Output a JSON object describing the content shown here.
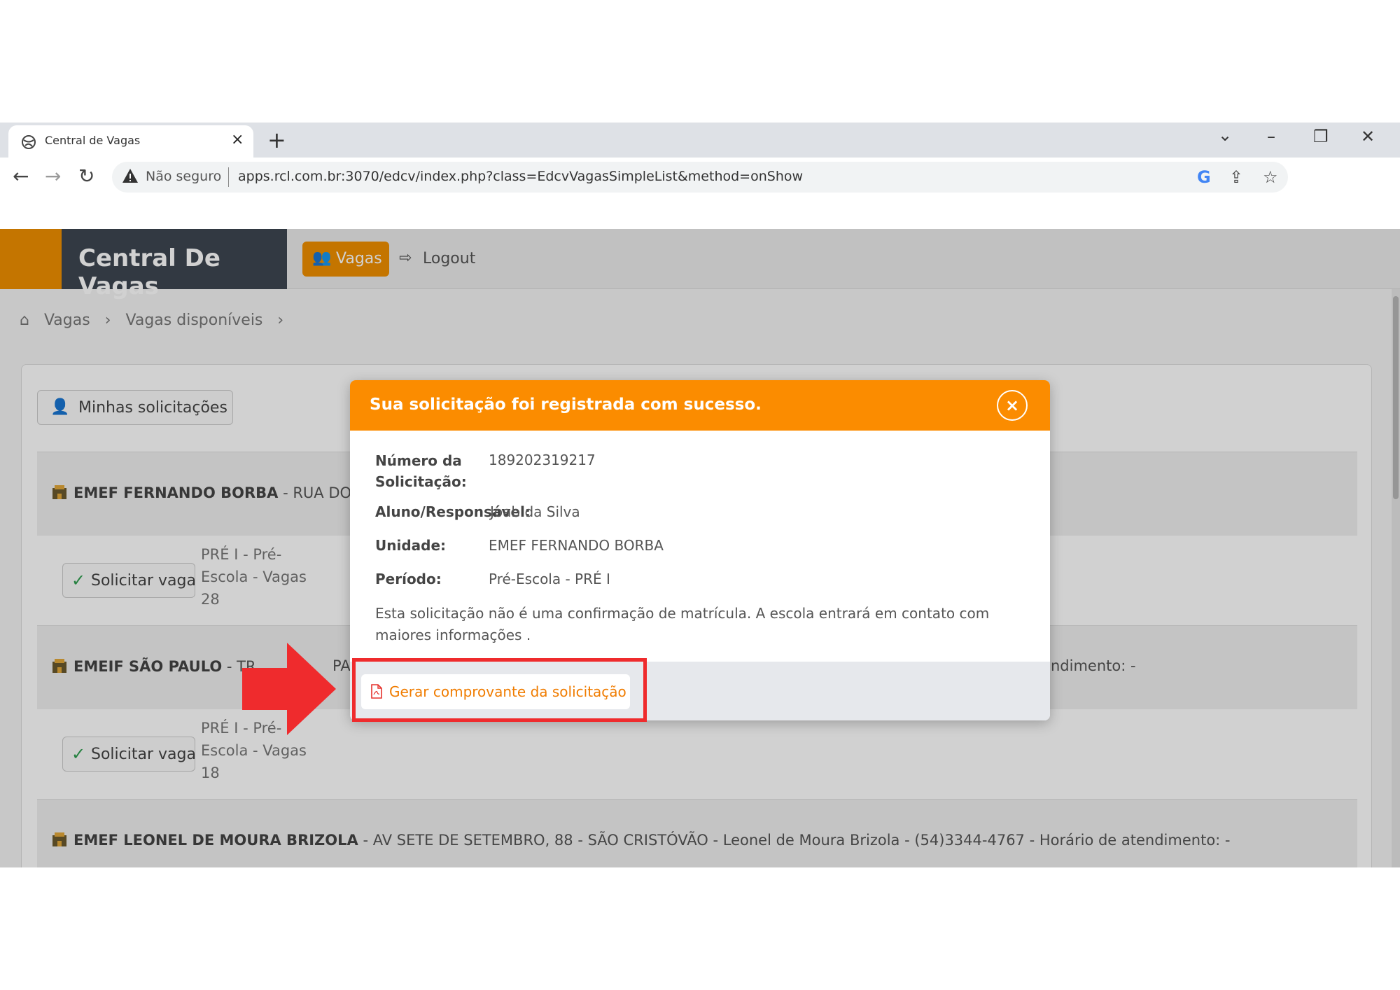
{
  "browser": {
    "tab_title": "Central de Vagas",
    "tab_close": "×",
    "new_tab": "+",
    "not_secure": "Não seguro",
    "url": "apps.rcl.com.br:3070/edcv/index.php?class=EdcvVagasSimpleList&method=onShow",
    "icons": [
      "back-icon",
      "forward-icon",
      "reload-icon",
      "warning-icon",
      "google-icon",
      "share-icon",
      "star-icon",
      "minimize-icon",
      "restore-icon",
      "close-icon",
      "chevron-down-icon"
    ]
  },
  "navbar": {
    "brand": "Central De Vagas",
    "vagas": "Vagas",
    "logout": "Logout",
    "brand_color": "#ef8f00",
    "dark_color": "#3e4651"
  },
  "breadcrumb": {
    "items": [
      "Vagas",
      "Vagas disponíveis"
    ],
    "separator": "›"
  },
  "panel": {
    "minhas_solicitacoes": "Minhas solicitações",
    "schools": [
      {
        "name": "EMEF FERNANDO BORBA",
        "visible_detail": " - RUA DO CO"
      },
      {
        "name": "EMEIF SÃO PAULO",
        "visible_detail": " - TR"
      },
      {
        "name": "EMEF LEONEL DE MOURA BRIZOLA",
        "visible_detail": " - AV SETE DE SETEMBRO, 88 - SÃO CRISTÓVÃO - Leonel de Moura Brizola - (54)3344-4767 - Horário de atendimento: -"
      }
    ],
    "row2_partial_text": "PA",
    "row2_partial_right": "ndimento: -",
    "vagas": [
      {
        "button": "Solicitar vaga",
        "description": "PRÉ I - Pré-Escola - Vagas 28"
      },
      {
        "button": "Solicitar vaga",
        "description": "PRÉ I - Pré-Escola - Vagas 18"
      }
    ]
  },
  "modal": {
    "title": "Sua solicitação foi registrada com sucesso.",
    "close": "×",
    "fields": [
      {
        "label": "Número da Solicitação:",
        "value": "189202319217"
      },
      {
        "label": "Aluno/Responsável:",
        "value": "Joab da Silva"
      },
      {
        "label": "Unidade:",
        "value": "EMEF FERNANDO BORBA"
      },
      {
        "label": "Período:",
        "value": "Pré-Escola - PRÉ I"
      }
    ],
    "note": "Esta solicitação não é uma confirmação de matrícula. A escola entrará em contato com maiores informações .",
    "button": "Gerar comprovante da solicitação",
    "header_color": "#fb8c00"
  },
  "annotation": {
    "highlight_color": "#ef2b2d",
    "arrow_color": "#ef2b2d"
  }
}
